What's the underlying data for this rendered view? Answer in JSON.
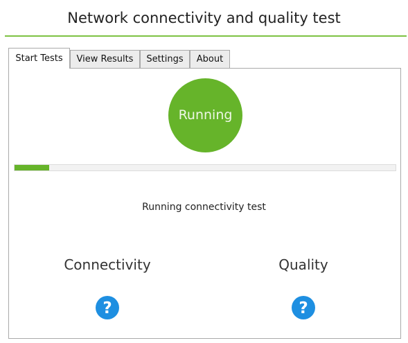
{
  "header": {
    "title": "Network connectivity and quality test"
  },
  "tabs": [
    {
      "label": "Start Tests",
      "active": true
    },
    {
      "label": "View Results",
      "active": false
    },
    {
      "label": "Settings",
      "active": false
    },
    {
      "label": "About",
      "active": false
    }
  ],
  "main": {
    "status_label": "Running",
    "progress": 0.09,
    "status_text": "Running connectivity test",
    "metrics": [
      {
        "label": "Connectivity",
        "icon": "question-icon"
      },
      {
        "label": "Quality",
        "icon": "question-icon"
      }
    ]
  },
  "colors": {
    "accent": "#66b42a",
    "rule": "#7dc242",
    "icon": "#1e8fe1"
  }
}
